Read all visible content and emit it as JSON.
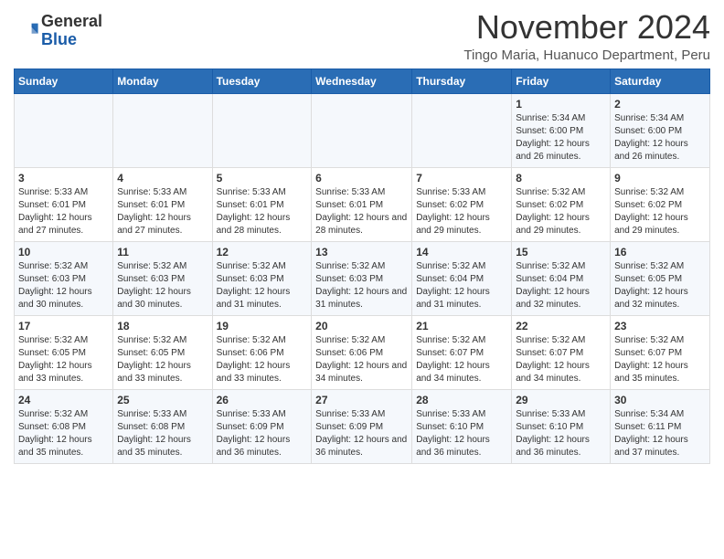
{
  "header": {
    "logo_general": "General",
    "logo_blue": "Blue",
    "month_title": "November 2024",
    "location": "Tingo Maria, Huanuco Department, Peru"
  },
  "days_of_week": [
    "Sunday",
    "Monday",
    "Tuesday",
    "Wednesday",
    "Thursday",
    "Friday",
    "Saturday"
  ],
  "weeks": [
    [
      {
        "day": "",
        "info": ""
      },
      {
        "day": "",
        "info": ""
      },
      {
        "day": "",
        "info": ""
      },
      {
        "day": "",
        "info": ""
      },
      {
        "day": "",
        "info": ""
      },
      {
        "day": "1",
        "info": "Sunrise: 5:34 AM\nSunset: 6:00 PM\nDaylight: 12 hours and 26 minutes."
      },
      {
        "day": "2",
        "info": "Sunrise: 5:34 AM\nSunset: 6:00 PM\nDaylight: 12 hours and 26 minutes."
      }
    ],
    [
      {
        "day": "3",
        "info": "Sunrise: 5:33 AM\nSunset: 6:01 PM\nDaylight: 12 hours and 27 minutes."
      },
      {
        "day": "4",
        "info": "Sunrise: 5:33 AM\nSunset: 6:01 PM\nDaylight: 12 hours and 27 minutes."
      },
      {
        "day": "5",
        "info": "Sunrise: 5:33 AM\nSunset: 6:01 PM\nDaylight: 12 hours and 28 minutes."
      },
      {
        "day": "6",
        "info": "Sunrise: 5:33 AM\nSunset: 6:01 PM\nDaylight: 12 hours and 28 minutes."
      },
      {
        "day": "7",
        "info": "Sunrise: 5:33 AM\nSunset: 6:02 PM\nDaylight: 12 hours and 29 minutes."
      },
      {
        "day": "8",
        "info": "Sunrise: 5:32 AM\nSunset: 6:02 PM\nDaylight: 12 hours and 29 minutes."
      },
      {
        "day": "9",
        "info": "Sunrise: 5:32 AM\nSunset: 6:02 PM\nDaylight: 12 hours and 29 minutes."
      }
    ],
    [
      {
        "day": "10",
        "info": "Sunrise: 5:32 AM\nSunset: 6:03 PM\nDaylight: 12 hours and 30 minutes."
      },
      {
        "day": "11",
        "info": "Sunrise: 5:32 AM\nSunset: 6:03 PM\nDaylight: 12 hours and 30 minutes."
      },
      {
        "day": "12",
        "info": "Sunrise: 5:32 AM\nSunset: 6:03 PM\nDaylight: 12 hours and 31 minutes."
      },
      {
        "day": "13",
        "info": "Sunrise: 5:32 AM\nSunset: 6:03 PM\nDaylight: 12 hours and 31 minutes."
      },
      {
        "day": "14",
        "info": "Sunrise: 5:32 AM\nSunset: 6:04 PM\nDaylight: 12 hours and 31 minutes."
      },
      {
        "day": "15",
        "info": "Sunrise: 5:32 AM\nSunset: 6:04 PM\nDaylight: 12 hours and 32 minutes."
      },
      {
        "day": "16",
        "info": "Sunrise: 5:32 AM\nSunset: 6:05 PM\nDaylight: 12 hours and 32 minutes."
      }
    ],
    [
      {
        "day": "17",
        "info": "Sunrise: 5:32 AM\nSunset: 6:05 PM\nDaylight: 12 hours and 33 minutes."
      },
      {
        "day": "18",
        "info": "Sunrise: 5:32 AM\nSunset: 6:05 PM\nDaylight: 12 hours and 33 minutes."
      },
      {
        "day": "19",
        "info": "Sunrise: 5:32 AM\nSunset: 6:06 PM\nDaylight: 12 hours and 33 minutes."
      },
      {
        "day": "20",
        "info": "Sunrise: 5:32 AM\nSunset: 6:06 PM\nDaylight: 12 hours and 34 minutes."
      },
      {
        "day": "21",
        "info": "Sunrise: 5:32 AM\nSunset: 6:07 PM\nDaylight: 12 hours and 34 minutes."
      },
      {
        "day": "22",
        "info": "Sunrise: 5:32 AM\nSunset: 6:07 PM\nDaylight: 12 hours and 34 minutes."
      },
      {
        "day": "23",
        "info": "Sunrise: 5:32 AM\nSunset: 6:07 PM\nDaylight: 12 hours and 35 minutes."
      }
    ],
    [
      {
        "day": "24",
        "info": "Sunrise: 5:32 AM\nSunset: 6:08 PM\nDaylight: 12 hours and 35 minutes."
      },
      {
        "day": "25",
        "info": "Sunrise: 5:33 AM\nSunset: 6:08 PM\nDaylight: 12 hours and 35 minutes."
      },
      {
        "day": "26",
        "info": "Sunrise: 5:33 AM\nSunset: 6:09 PM\nDaylight: 12 hours and 36 minutes."
      },
      {
        "day": "27",
        "info": "Sunrise: 5:33 AM\nSunset: 6:09 PM\nDaylight: 12 hours and 36 minutes."
      },
      {
        "day": "28",
        "info": "Sunrise: 5:33 AM\nSunset: 6:10 PM\nDaylight: 12 hours and 36 minutes."
      },
      {
        "day": "29",
        "info": "Sunrise: 5:33 AM\nSunset: 6:10 PM\nDaylight: 12 hours and 36 minutes."
      },
      {
        "day": "30",
        "info": "Sunrise: 5:34 AM\nSunset: 6:11 PM\nDaylight: 12 hours and 37 minutes."
      }
    ]
  ]
}
